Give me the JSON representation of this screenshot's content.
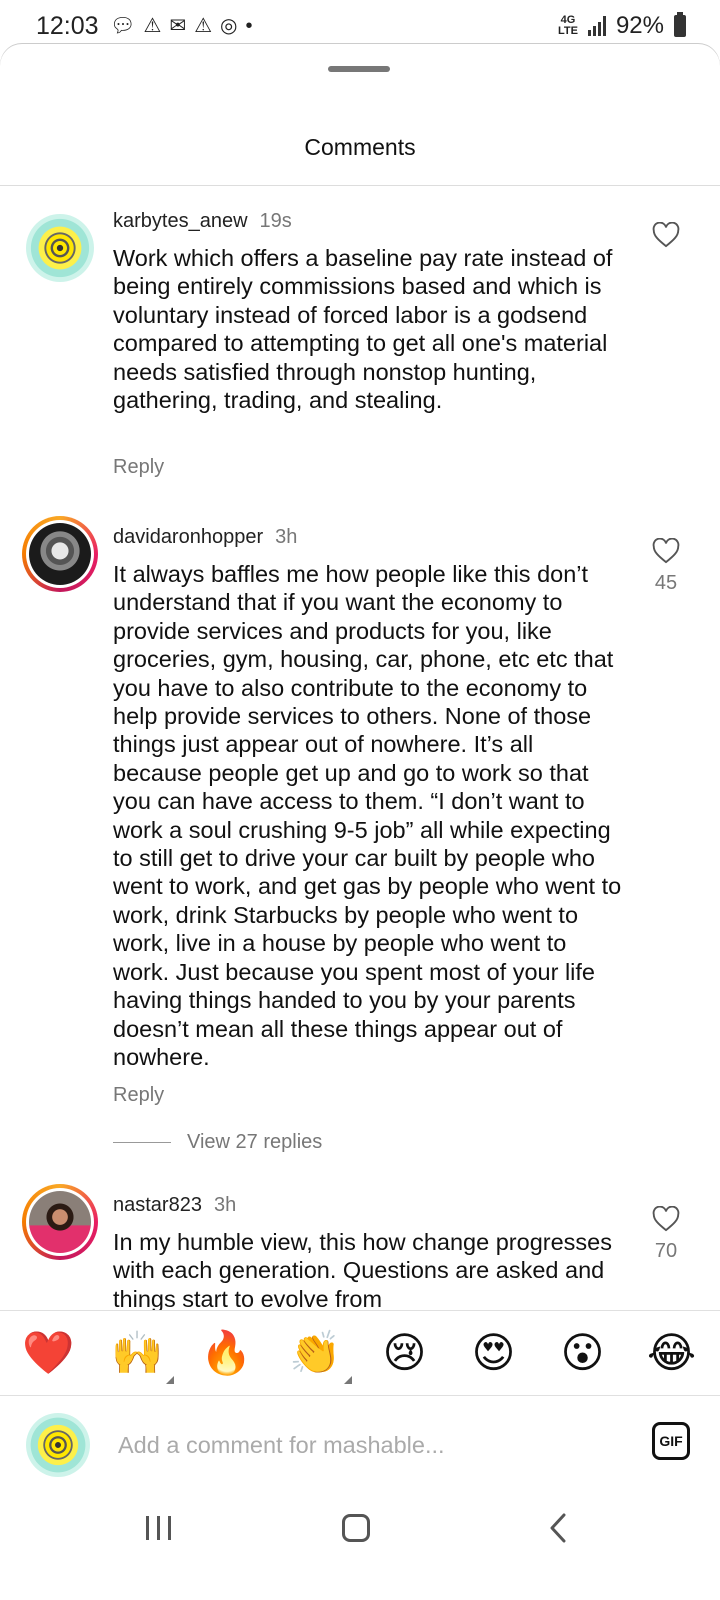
{
  "status_bar": {
    "time": "12:03",
    "notification_icons": [
      "chat-icon",
      "warning-icon",
      "gmail-icon",
      "warning-icon",
      "messenger-icon",
      "dot-icon"
    ],
    "network": "4G LTE",
    "battery": "92%"
  },
  "sheet": {
    "title": "Comments"
  },
  "comments": [
    {
      "username": "karbytes_anew",
      "time": "19s",
      "text": "Work which offers a baseline pay rate instead of being entirely commissions based and which is voluntary instead of forced labor is a godsend compared to attempting to get all one's material needs satisfied through nonstop hunting, gathering, trading, and stealing.",
      "reply_label": "Reply",
      "likes": ""
    },
    {
      "username": "davidaronhopper",
      "time": "3h",
      "text": "It always baffles me how people like this don’t understand that if you want the economy to provide services and products for you, like groceries, gym, housing, car, phone, etc etc that you have to also contribute to the economy to help provide services to others. None of those things just appear out of nowhere. It’s all because people get up and go to work so that you can have access to them. “I don’t want to work a soul crushing 9-5 job” all while expecting to still get to drive your car built by people who went to work, and get gas by people who went to work, drink Starbucks by people who went to work, live in a house by people who went to work. Just because you spent most of your life having things handed to you by your parents doesn’t mean all these things appear out of nowhere.",
      "reply_label": "Reply",
      "likes": "45",
      "view_replies": "View 27 replies"
    },
    {
      "username": "nastar823",
      "time": "3h",
      "text": "In my humble view,  this how change progresses with each generation.  Questions are asked and things start to evolve from",
      "likes": "70"
    }
  ],
  "emoji_bar": {
    "emojis": [
      "❤️",
      "🙌",
      "🔥",
      "👏",
      "😢",
      "😍",
      "😮",
      "😂"
    ]
  },
  "comment_input": {
    "placeholder": "Add a comment for mashable...",
    "gif_label": "GIF"
  }
}
